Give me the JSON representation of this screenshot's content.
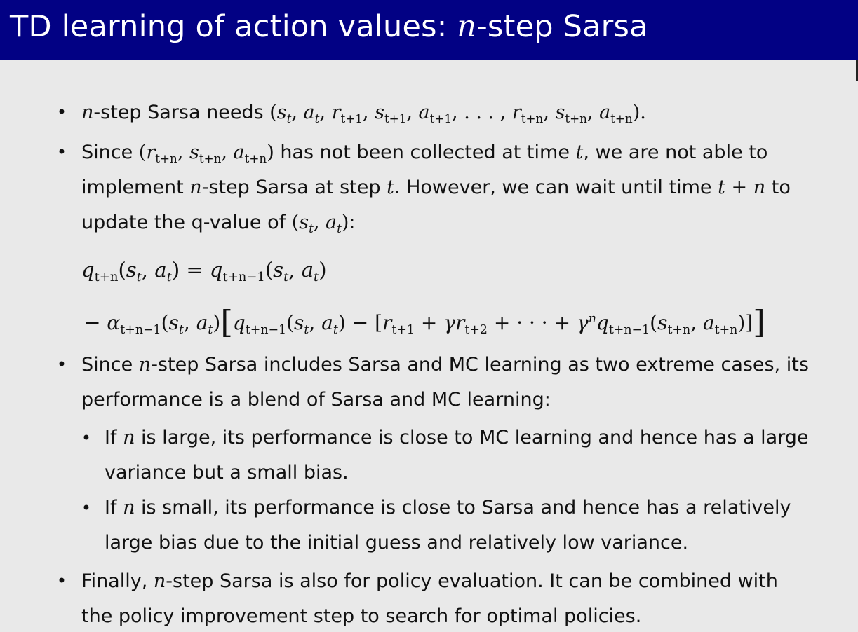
{
  "slide": {
    "title_prefix": "TD learning of action values: ",
    "title_var": "n",
    "title_suffix": "-step Sarsa"
  },
  "bullets": {
    "b1": {
      "var_n": "n",
      "text": "-step Sarsa needs ",
      "math": "(s_t, a_t, r_{t+1}, s_{t+1}, a_{t+1}, ..., r_{t+n}, s_{t+n}, a_{t+n})."
    },
    "b2": {
      "p1": "Since ",
      "math1": "(r_{t+n}, s_{t+n}, a_{t+n})",
      "p2": " has not been collected at time ",
      "var_t1": "t",
      "p3": ", we are not able to",
      "p4": "implement ",
      "var_n": "n",
      "p5": "-step Sarsa at step ",
      "var_t2": "t",
      "p6": ". However, we can wait until time ",
      "math2": "t + n",
      "p7": " to",
      "p8": "update the q-value of ",
      "math3": "(s_t, a_t)",
      "p9": ":"
    },
    "b3": {
      "p1": "Since ",
      "var_n": "n",
      "p2": "-step Sarsa includes Sarsa and MC learning as two extreme cases, its",
      "p3": "performance is a blend of Sarsa and MC learning:"
    },
    "sub1": {
      "p1": "If ",
      "var_n": "n",
      "p2": " is large, its performance is close to MC learning and hence has a large",
      "p3": "variance but a small bias."
    },
    "sub2": {
      "p1": "If ",
      "var_n": "n",
      "p2": " is small, its performance is close to Sarsa and hence has a relatively",
      "p3": "large bias due to the initial guess and relatively low variance."
    },
    "b4": {
      "p1": "Finally, ",
      "var_n": "n",
      "p2": "-step Sarsa is also for policy evaluation. It can be combined with",
      "p3": "the policy improvement step to search for optimal policies."
    }
  },
  "equation": {
    "line1": "q_{t+n}(s_t, a_t) = q_{t+n-1}(s_t, a_t)",
    "line2": "- α_{t+n-1}(s_t, a_t)[q_{t+n-1}(s_t, a_t) - [r_{t+1} + γr_{t+2} + ··· + γ^n q_{t+n-1}(s_{t+n}, a_{t+n})]]"
  },
  "colors": {
    "header_bg": "#020184",
    "page_bg": "#e9e9e9",
    "text": "#111111",
    "title_text": "#ffffff"
  }
}
